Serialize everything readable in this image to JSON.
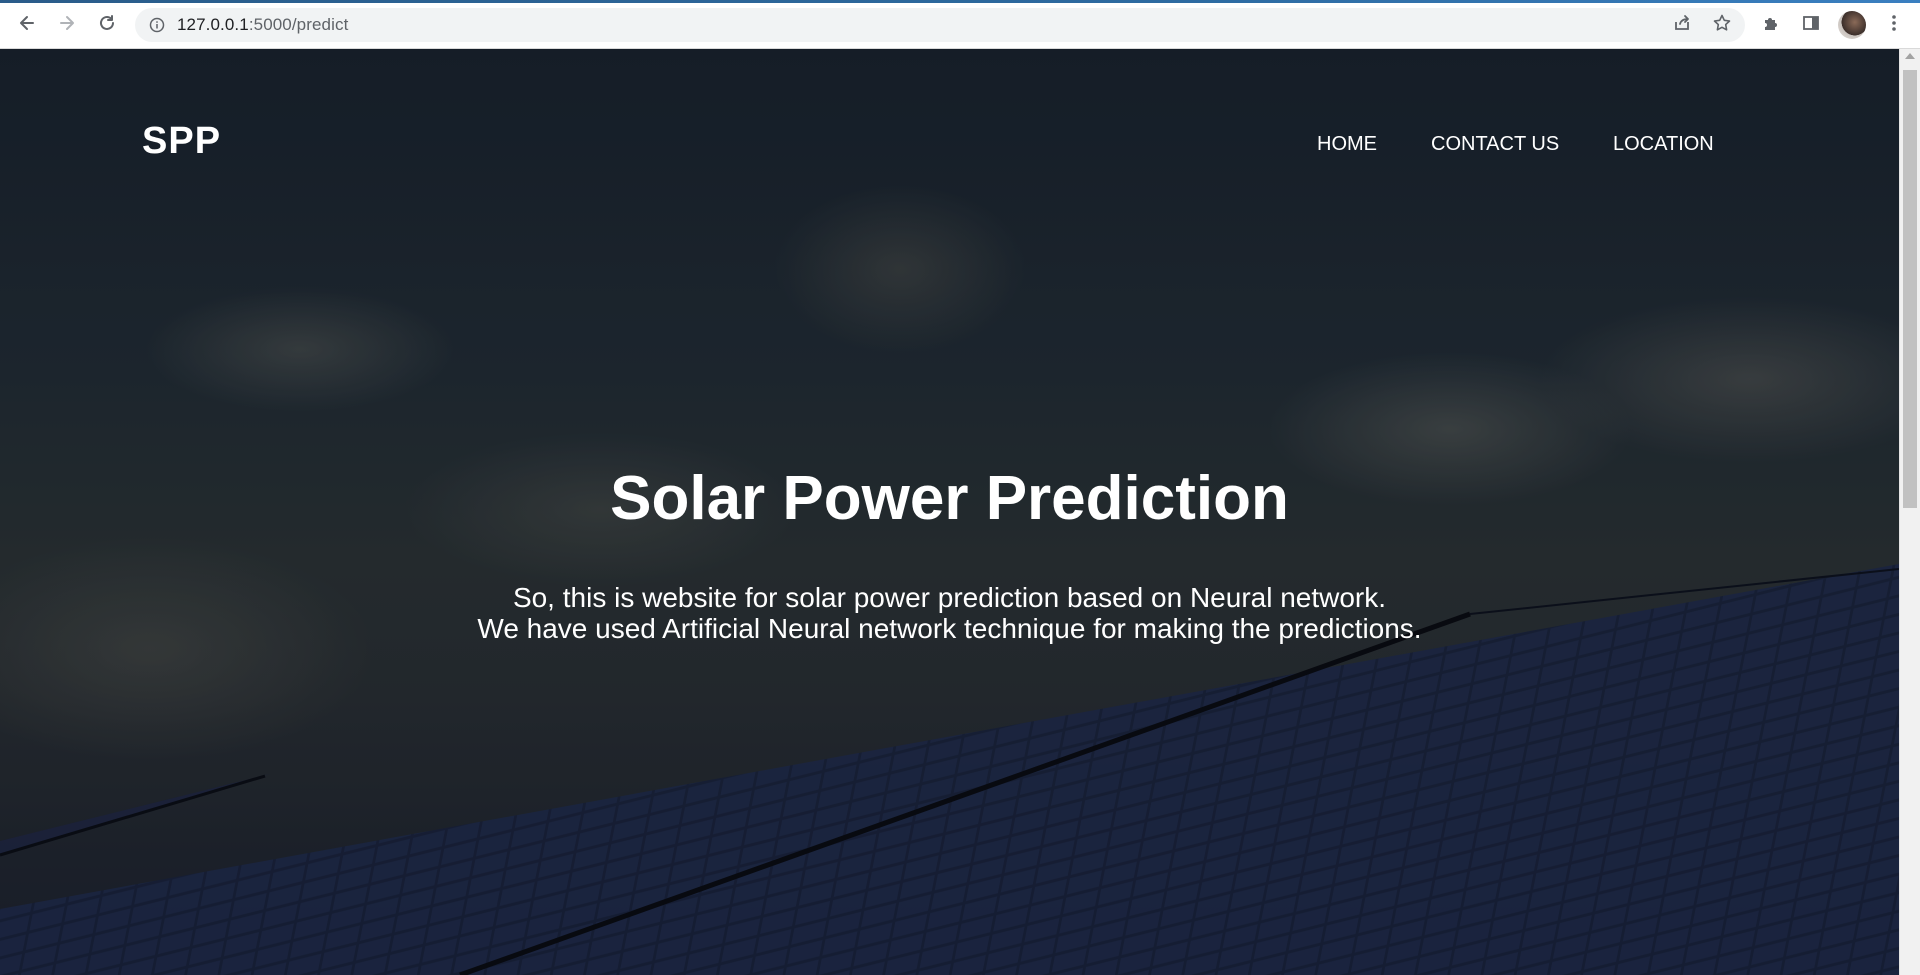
{
  "browser": {
    "url_host": "127.0.0.1",
    "url_path": ":5000/predict",
    "icons": {
      "back": "arrow-left-icon",
      "forward": "arrow-right-icon",
      "reload": "reload-icon",
      "site_info": "info-circle-icon",
      "share": "share-icon",
      "bookmark": "star-icon",
      "extensions": "puzzle-icon",
      "side_panel": "side-panel-icon",
      "menu": "kebab-menu-icon"
    }
  },
  "site": {
    "brand": "SPP",
    "nav": [
      {
        "label": "HOME"
      },
      {
        "label": "CONTACT US"
      },
      {
        "label": "LOCATION"
      }
    ]
  },
  "hero": {
    "title": "Solar Power Prediction",
    "description_line1": "So, this is website for solar power prediction based on Neural network.",
    "description_line2": "We have used Artificial Neural network technique for making the predictions."
  },
  "colors": {
    "chrome_bg": "#ffffff",
    "omnibox_bg": "#f1f3f4",
    "hero_text": "#ffffff",
    "hero_bg_dark": "#1b2530"
  }
}
